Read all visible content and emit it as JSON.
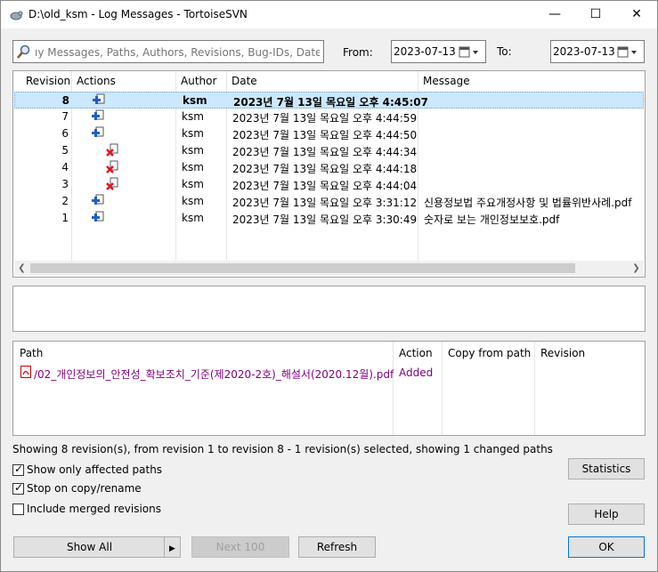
{
  "window": {
    "title": "D:\\old_ksm - Log Messages - TortoiseSVN",
    "minimize": "—",
    "maximize": "☐",
    "close": "✕"
  },
  "filter": {
    "placeholder": "ıy Messages, Paths, Authors, Revisions, Bug-IDs, Date, Dat",
    "from_label": "From:",
    "from_value": "2023-07-13",
    "to_label": "To:",
    "to_value": "2023-07-13"
  },
  "log": {
    "headers": [
      "Revision",
      "Actions",
      "Author",
      "Date",
      "Message"
    ],
    "rows": [
      {
        "revision": "8",
        "action": "add",
        "author": "ksm",
        "date": "2023년 7월 13일 목요일 오후 4:45:07",
        "message": "",
        "selected": true
      },
      {
        "revision": "7",
        "action": "add",
        "author": "ksm",
        "date": "2023년 7월 13일 목요일 오후 4:44:59",
        "message": ""
      },
      {
        "revision": "6",
        "action": "add",
        "author": "ksm",
        "date": "2023년 7월 13일 목요일 오후 4:44:50",
        "message": ""
      },
      {
        "revision": "5",
        "action": "delete",
        "author": "ksm",
        "date": "2023년 7월 13일 목요일 오후 4:44:34",
        "message": ""
      },
      {
        "revision": "4",
        "action": "delete",
        "author": "ksm",
        "date": "2023년 7월 13일 목요일 오후 4:44:18",
        "message": ""
      },
      {
        "revision": "3",
        "action": "delete",
        "author": "ksm",
        "date": "2023년 7월 13일 목요일 오후 4:44:04",
        "message": ""
      },
      {
        "revision": "2",
        "action": "add",
        "author": "ksm",
        "date": "2023년 7월 13일 목요일 오후 3:31:12",
        "message": "신용정보법 주요개정사항 및 법률위반사례.pdf"
      },
      {
        "revision": "1",
        "action": "add",
        "author": "ksm",
        "date": "2023년 7월 13일 목요일 오후 3:30:49",
        "message": "숫자로 보는 개인정보보호.pdf"
      }
    ]
  },
  "paths": {
    "headers": [
      "Path",
      "Action",
      "Copy from path",
      "Revision"
    ],
    "rows": [
      {
        "path": "/02_개인정보의_안전성_확보조치_기준(제2020-2호)_해설서(2020.12월).pdf",
        "action": "Added",
        "copy_from": "",
        "revision": ""
      }
    ]
  },
  "status": "Showing 8 revision(s), from revision 1 to revision 8 - 1 revision(s) selected, showing 1 changed paths",
  "options": {
    "affected_paths": {
      "label": "Show only affected paths",
      "checked": true
    },
    "stop_on_copy": {
      "label": "Stop on copy/rename",
      "checked": true
    },
    "include_merged": {
      "label": "Include merged revisions",
      "checked": false
    }
  },
  "buttons": {
    "statistics": "Statistics",
    "help": "Help",
    "show_all": "Show All",
    "next_100": "Next 100",
    "refresh": "Refresh",
    "ok": "OK"
  },
  "colors": {
    "selection": "#cce8ff",
    "added_text": "#800080",
    "delete_red": "#e81123",
    "add_blue": "#1e5fc8"
  }
}
